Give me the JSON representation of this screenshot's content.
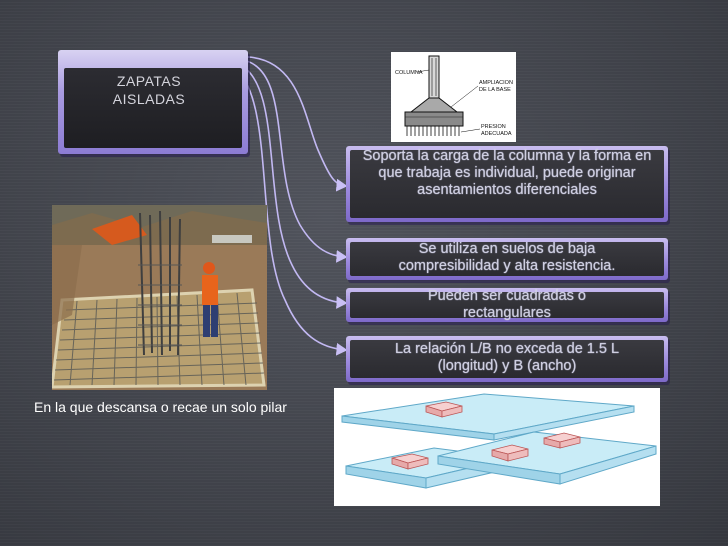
{
  "title": {
    "line1": "ZAPATAS",
    "line2": "AISLADAS"
  },
  "boxes": [
    {
      "text": "Soporta la carga de la columna y la forma en que trabaja es individual, puede originar asentamientos diferenciales"
    },
    {
      "text": "Se utiliza en suelos de baja compresibilidad y alta resistencia."
    },
    {
      "text": "Pueden ser cuadradas o rectangulares"
    },
    {
      "text": "La relación L/B no exceda de 1.5 L (longitud) y B (ancho)"
    }
  ],
  "caption": "En la que descansa o recae un solo pilar",
  "diagram_labels": {
    "columna": "COLUMNA",
    "ampliacion_line1": "AMPLIACION",
    "ampliacion_line2": "DE LA BASE",
    "presion_line1": "PRESION",
    "presion_line2": "ADECUADA"
  },
  "colors": {
    "box_border": "#9d8bde",
    "box_fill": "#2f2f34",
    "background": "#4a4d56",
    "arrow": "#b8aef0"
  }
}
